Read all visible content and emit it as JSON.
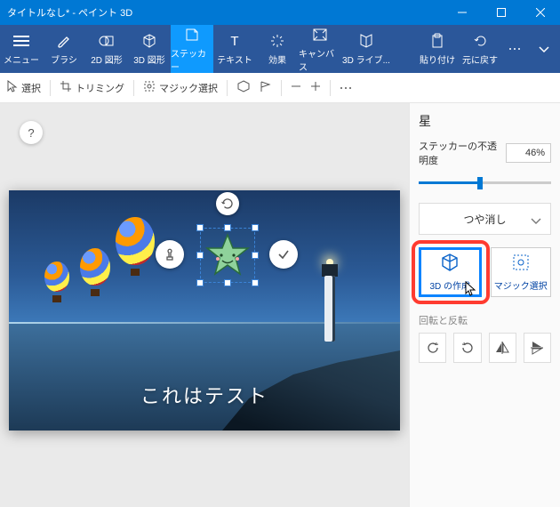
{
  "window": {
    "title": "タイトルなし* - ペイント 3D"
  },
  "ribbon": {
    "menu": "メニュー",
    "brush": "ブラシ",
    "shape2d": "2D 図形",
    "shape3d": "3D 図形",
    "sticker": "ステッカー",
    "text": "テキスト",
    "effects": "効果",
    "canvas": "キャンバス",
    "lib3d": "3D ライブ...",
    "paste": "貼り付け",
    "undo": "元に戻す"
  },
  "toolbar": {
    "select": "選択",
    "trimming": "トリミング",
    "magic": "マジック選択"
  },
  "canvas": {
    "help": "?",
    "caption": "これはテスト"
  },
  "panel": {
    "heading": "星",
    "opacity_label": "ステッカーの不透明度",
    "opacity_value": "46%",
    "opacity_percent": 46,
    "matte": "つや消し",
    "make3d": "3D の作成",
    "magic_select": "マジック選択",
    "rotate_flip": "回転と反転"
  }
}
